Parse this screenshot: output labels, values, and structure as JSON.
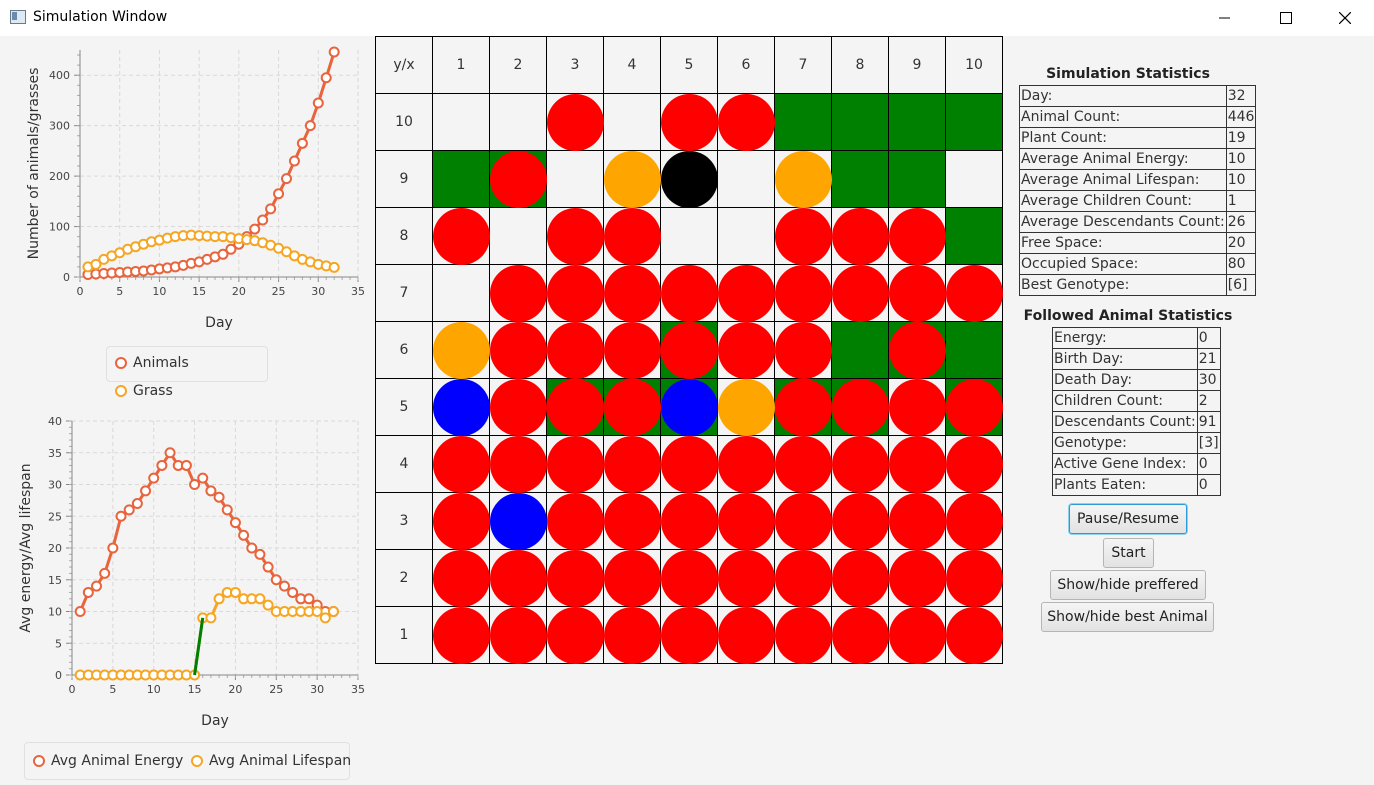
{
  "window": {
    "title": "Simulation Window"
  },
  "colors": {
    "animal": "#ff0000",
    "grass": "#008000",
    "empty": "#f4f4f4",
    "followed": "#0000ff",
    "best": "#ffa500",
    "dead": "#000000"
  },
  "population_chart": {
    "ylabel": "Number of animals/grasses",
    "xlabel": "Day",
    "legend": [
      "Animals",
      "Grass"
    ],
    "chart_data": {
      "type": "line",
      "xlabel": "Day",
      "ylabel": "Number of animals/grasses",
      "xlim": [
        0,
        35
      ],
      "ylim": [
        0,
        450
      ],
      "xticks": [
        "0",
        "5",
        "10",
        "15",
        "20",
        "25",
        "30",
        "35"
      ],
      "yticks": [
        "0",
        "100",
        "200",
        "300",
        "400"
      ],
      "grid": true,
      "legend_position": "bottom",
      "series": [
        {
          "name": "Animals",
          "color": "#e8643c",
          "x": [
            1,
            2,
            3,
            4,
            5,
            6,
            7,
            8,
            9,
            10,
            11,
            12,
            13,
            14,
            15,
            16,
            17,
            18,
            19,
            20,
            21,
            22,
            23,
            24,
            25,
            26,
            27,
            28,
            29,
            30,
            31,
            32
          ],
          "y": [
            5,
            6,
            7,
            8,
            9,
            10,
            11,
            12,
            14,
            16,
            18,
            20,
            23,
            27,
            30,
            35,
            40,
            45,
            55,
            65,
            80,
            95,
            113,
            135,
            165,
            195,
            230,
            265,
            300,
            345,
            395,
            446
          ]
        },
        {
          "name": "Grass",
          "color": "#f5a623",
          "x": [
            1,
            2,
            3,
            4,
            5,
            6,
            7,
            8,
            9,
            10,
            11,
            12,
            13,
            14,
            15,
            16,
            17,
            18,
            19,
            20,
            21,
            22,
            23,
            24,
            25,
            26,
            27,
            28,
            29,
            30,
            31,
            32
          ],
          "y": [
            20,
            25,
            35,
            42,
            48,
            55,
            60,
            65,
            70,
            73,
            77,
            80,
            82,
            83,
            82,
            81,
            80,
            80,
            78,
            76,
            74,
            72,
            68,
            63,
            57,
            50,
            42,
            35,
            30,
            25,
            22,
            19
          ]
        }
      ]
    }
  },
  "energy_chart": {
    "ylabel": "Avg energy/Avg lifespan",
    "xlabel": "Day",
    "legend": [
      "Avg Animal Energy",
      "Avg Animal Lifespan"
    ],
    "chart_data": {
      "type": "line",
      "xlabel": "Day",
      "ylabel": "Avg energy/Avg lifespan",
      "xlim": [
        0,
        35
      ],
      "ylim": [
        0,
        40
      ],
      "xticks": [
        "0",
        "5",
        "10",
        "15",
        "20",
        "25",
        "30",
        "35"
      ],
      "yticks": [
        "0",
        "5",
        "10",
        "15",
        "20",
        "25",
        "30",
        "35",
        "40"
      ],
      "grid": true,
      "legend_position": "bottom",
      "series": [
        {
          "name": "Avg Animal Energy",
          "color": "#e8643c",
          "x": [
            1,
            2,
            3,
            4,
            5,
            6,
            7,
            8,
            9,
            10,
            11,
            12,
            13,
            14,
            15,
            16,
            17,
            18,
            19,
            20,
            21,
            22,
            23,
            24,
            25,
            26,
            27,
            28,
            29,
            30,
            31,
            32
          ],
          "y": [
            10,
            13,
            14,
            16,
            20,
            25,
            26,
            27,
            29,
            31,
            33,
            35,
            33,
            33,
            30,
            31,
            29,
            28,
            26,
            24,
            22,
            20,
            19,
            17,
            15,
            14,
            13,
            12,
            12,
            11,
            10,
            10
          ]
        },
        {
          "name": "Avg Animal Lifespan",
          "color": "#f5a623",
          "x": [
            1,
            2,
            3,
            4,
            5,
            6,
            7,
            8,
            9,
            10,
            11,
            12,
            13,
            14,
            15,
            16,
            17,
            18,
            19,
            20,
            21,
            22,
            23,
            24,
            25,
            26,
            27,
            28,
            29,
            30,
            31,
            32
          ],
          "y": [
            0,
            0,
            0,
            0,
            0,
            0,
            0,
            0,
            0,
            0,
            0,
            0,
            0,
            0,
            0,
            9,
            9,
            12,
            13,
            13,
            12,
            12,
            12,
            11,
            10,
            10,
            10,
            10,
            10,
            10,
            9,
            10
          ]
        }
      ]
    }
  },
  "map": {
    "corner": "y/x",
    "columns": [
      "1",
      "2",
      "3",
      "4",
      "5",
      "6",
      "7",
      "8",
      "9",
      "10"
    ],
    "rows": [
      {
        "label": "10",
        "cells": [
          "e",
          "e",
          "A",
          "e",
          "A",
          "A",
          "G",
          "G",
          "G",
          "G"
        ]
      },
      {
        "label": "9",
        "cells": [
          "G",
          "GA",
          "e",
          "B",
          "D",
          "e",
          "B",
          "G",
          "G",
          "e"
        ]
      },
      {
        "label": "8",
        "cells": [
          "A",
          "e",
          "A",
          "A",
          "e",
          "e",
          "A",
          "A",
          "A",
          "G"
        ]
      },
      {
        "label": "7",
        "cells": [
          "e",
          "A",
          "A",
          "A",
          "A",
          "A",
          "A",
          "A",
          "A",
          "A"
        ]
      },
      {
        "label": "6",
        "cells": [
          "B",
          "A",
          "A",
          "A",
          "GA",
          "A",
          "A",
          "G",
          "GA",
          "G"
        ]
      },
      {
        "label": "5",
        "cells": [
          "F",
          "A",
          "GA",
          "GA",
          "GF",
          "B",
          "GA",
          "GA",
          "A",
          "GA"
        ]
      },
      {
        "label": "4",
        "cells": [
          "A",
          "A",
          "A",
          "A",
          "A",
          "A",
          "A",
          "A",
          "A",
          "A"
        ]
      },
      {
        "label": "3",
        "cells": [
          "A",
          "F",
          "A",
          "A",
          "A",
          "A",
          "A",
          "A",
          "A",
          "A"
        ]
      },
      {
        "label": "2",
        "cells": [
          "A",
          "A",
          "A",
          "A",
          "A",
          "A",
          "A",
          "A",
          "A",
          "A"
        ]
      },
      {
        "label": "1",
        "cells": [
          "A",
          "A",
          "A",
          "A",
          "A",
          "A",
          "A",
          "A",
          "A",
          "A"
        ]
      }
    ]
  },
  "simulation_stats": {
    "title": "Simulation Statistics",
    "rows": [
      {
        "label": "Day:",
        "value": "32"
      },
      {
        "label": "Animal Count:",
        "value": "446"
      },
      {
        "label": "Plant Count:",
        "value": "19"
      },
      {
        "label": "Average Animal Energy:",
        "value": "10"
      },
      {
        "label": "Average Animal Lifespan:",
        "value": "10"
      },
      {
        "label": "Average Children Count:",
        "value": "1"
      },
      {
        "label": "Average Descendants Count:",
        "value": "26"
      },
      {
        "label": "Free Space:",
        "value": "20"
      },
      {
        "label": "Occupied Space:",
        "value": "80"
      },
      {
        "label": "Best Genotype:",
        "value": "[6]"
      }
    ]
  },
  "followed_stats": {
    "title": "Followed Animal Statistics",
    "rows": [
      {
        "label": "Energy:",
        "value": "0"
      },
      {
        "label": "Birth Day:",
        "value": "21"
      },
      {
        "label": "Death Day:",
        "value": "30"
      },
      {
        "label": "Children Count:",
        "value": "2"
      },
      {
        "label": "Descendants Count:",
        "value": "91"
      },
      {
        "label": "Genotype:",
        "value": "[3]"
      },
      {
        "label": "Active Gene Index:",
        "value": "0"
      },
      {
        "label": "Plants Eaten:",
        "value": "0"
      }
    ]
  },
  "buttons": {
    "pause": "Pause/Resume",
    "start": "Start",
    "preferred": "Show/hide preffered",
    "best": "Show/hide best Animal"
  }
}
